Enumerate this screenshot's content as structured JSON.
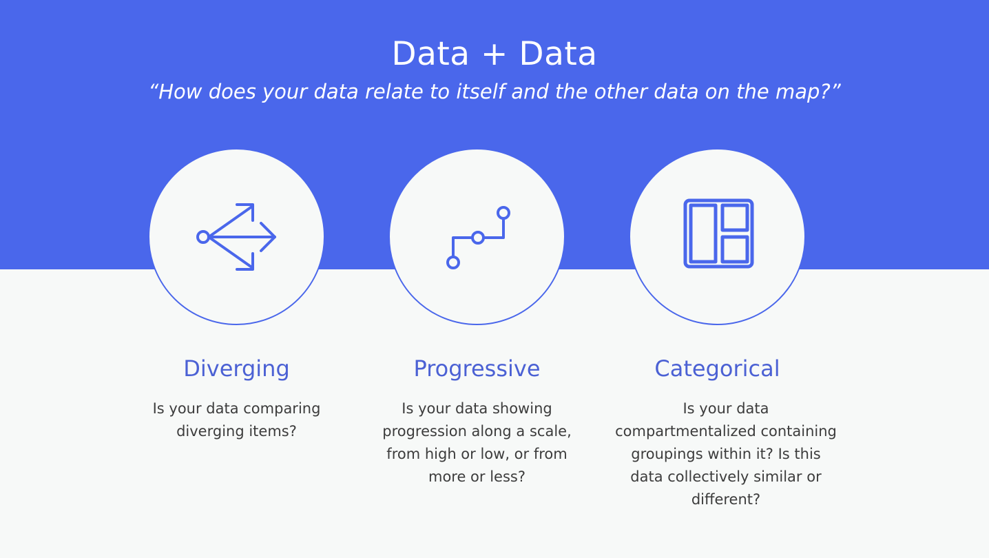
{
  "header": {
    "title": "Data + Data",
    "subtitle": "“How does your data relate to itself and the other data on the map?”"
  },
  "cards": [
    {
      "icon": "diverging-arrows-icon",
      "title": "Diverging",
      "description": "Is your data comparing diverging items?"
    },
    {
      "icon": "progression-path-icon",
      "title": "Progressive",
      "description": "Is your data showing progression along a scale, from high or low, or from more or less?"
    },
    {
      "icon": "categorical-grid-icon",
      "title": "Categorical",
      "description": "Is your data compartmentalized containing groupings within it? Is this data collectively similar or different?"
    }
  ],
  "colors": {
    "band": "#4a67eb",
    "background": "#f7f9f8",
    "accent_text": "#4b61d4",
    "body_text": "#3c3c3c"
  }
}
